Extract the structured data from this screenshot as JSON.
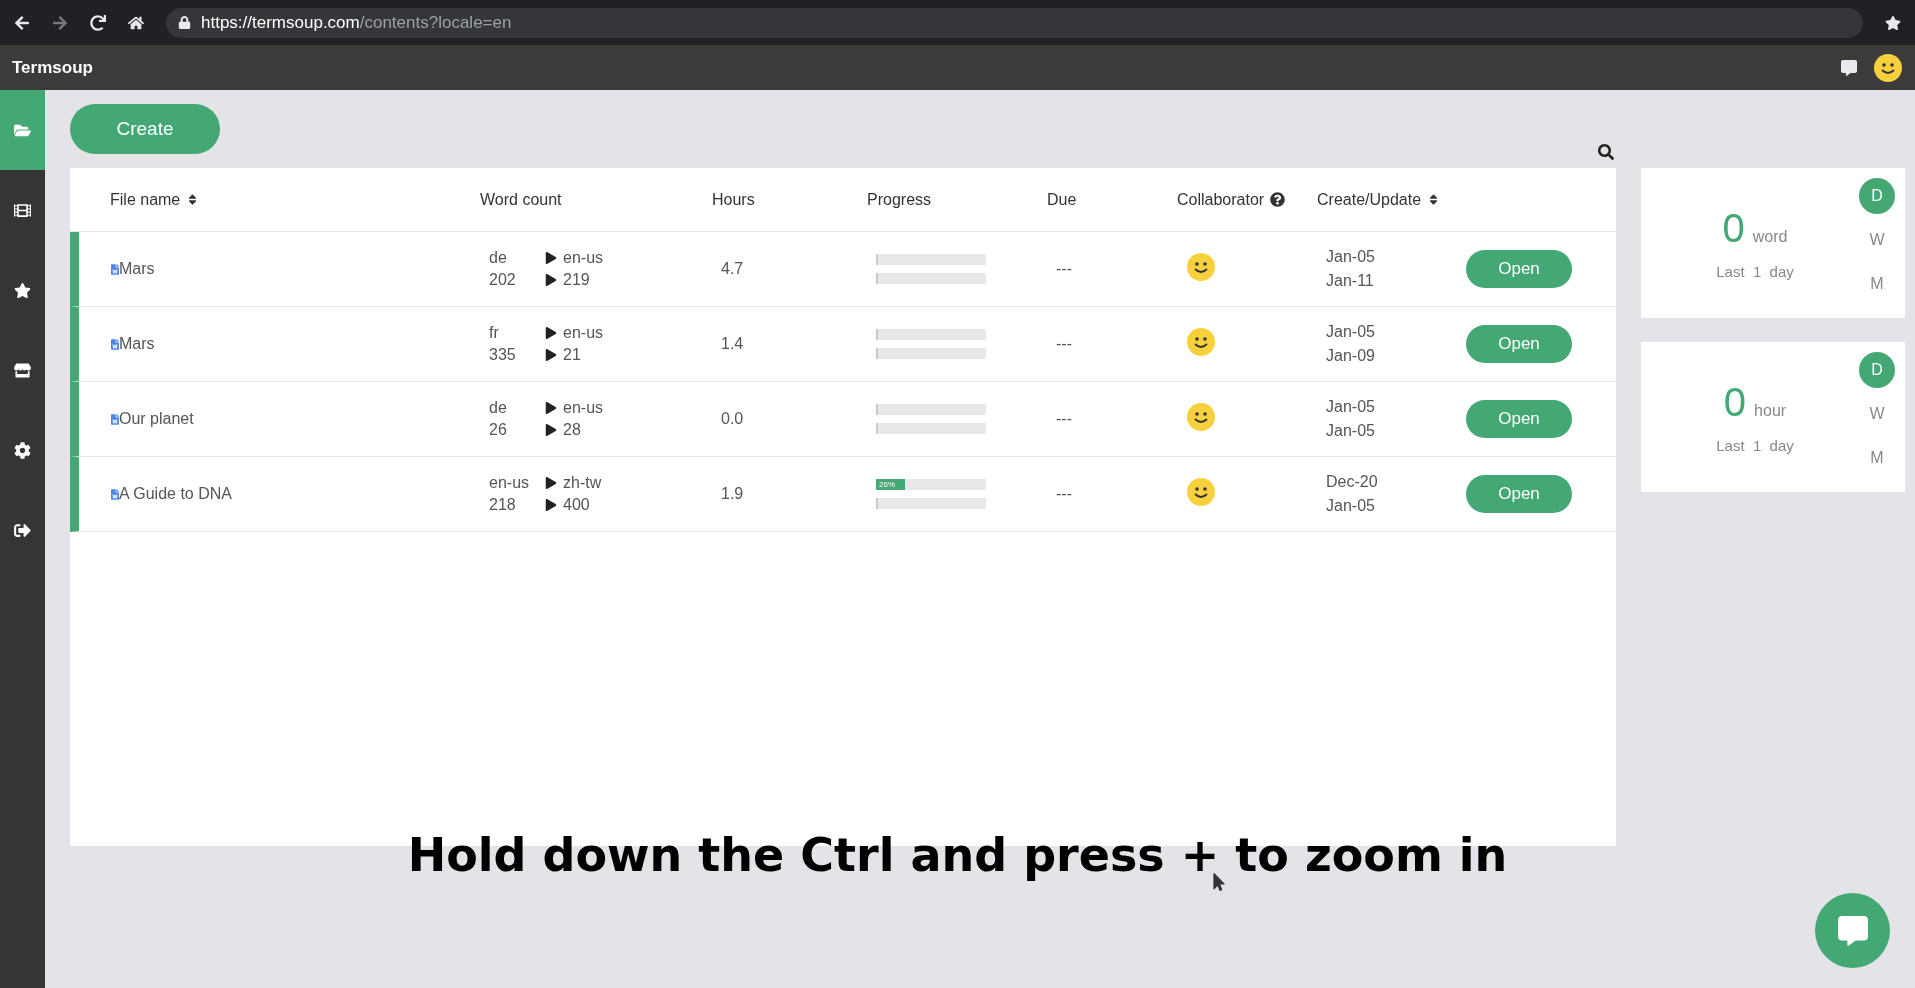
{
  "browser": {
    "host": "https://termsoup.com",
    "path": "/contents?locale=en"
  },
  "app": {
    "title": "Termsoup"
  },
  "sidebar": {
    "items": [
      {
        "kind": "folder",
        "selected": true
      },
      {
        "kind": "film",
        "selected": false
      },
      {
        "kind": "star",
        "selected": false
      },
      {
        "kind": "store",
        "selected": false
      },
      {
        "kind": "settings",
        "selected": false
      },
      {
        "kind": "logout",
        "selected": false
      }
    ]
  },
  "create_button": "Create",
  "table": {
    "columns": [
      {
        "label": "File name",
        "sortable": true
      },
      {
        "label": "Word count",
        "sortable": false
      },
      {
        "label": "Hours",
        "sortable": false
      },
      {
        "label": "Progress",
        "sortable": false
      },
      {
        "label": "Due",
        "sortable": false
      },
      {
        "label": "Collaborator",
        "sortable": false,
        "help": true
      },
      {
        "label": "Create/Update",
        "sortable": true
      }
    ],
    "rows": [
      {
        "name": "Mars",
        "source_lang": "de",
        "target_lang": "en-us",
        "source_count": "202",
        "target_count": "219",
        "hours": "4.7",
        "progress": [
          {
            "level": 0
          },
          {
            "level": 0
          }
        ],
        "due": "---",
        "created": "Jan-05",
        "updated": "Jan-11",
        "action": "Open"
      },
      {
        "name": "Mars",
        "source_lang": "fr",
        "target_lang": "en-us",
        "source_count": "335",
        "target_count": "21",
        "hours": "1.4",
        "progress": [
          {
            "level": 0
          },
          {
            "level": 0
          }
        ],
        "due": "---",
        "created": "Jan-05",
        "updated": "Jan-09",
        "action": "Open"
      },
      {
        "name": "Our planet",
        "source_lang": "de",
        "target_lang": "en-us",
        "source_count": "26",
        "target_count": "28",
        "hours": "0.0",
        "progress": [
          {
            "level": 0
          },
          {
            "level": 0
          }
        ],
        "due": "---",
        "created": "Jan-05",
        "updated": "Jan-05",
        "action": "Open"
      },
      {
        "name": "A Guide to DNA",
        "source_lang": "en-us",
        "target_lang": "zh-tw",
        "source_count": "218",
        "target_count": "400",
        "hours": "1.9",
        "progress": [
          {
            "level": 0.26,
            "label": "26%"
          },
          {
            "level": 0
          }
        ],
        "due": "---",
        "created": "Dec-20",
        "updated": "Jan-05",
        "action": "Open"
      }
    ]
  },
  "stats": [
    {
      "value": "0",
      "unit": "word",
      "period_text": "Last  1  day",
      "periods": [
        {
          "label": "D",
          "selected": true
        },
        {
          "label": "W",
          "selected": false
        },
        {
          "label": "M",
          "selected": false
        }
      ]
    },
    {
      "value": "0",
      "unit": "hour",
      "period_text": "Last  1  day",
      "periods": [
        {
          "label": "D",
          "selected": true
        },
        {
          "label": "W",
          "selected": false
        },
        {
          "label": "M",
          "selected": false
        }
      ]
    }
  ],
  "caption": "Hold down the Ctrl and press + to zoom in"
}
